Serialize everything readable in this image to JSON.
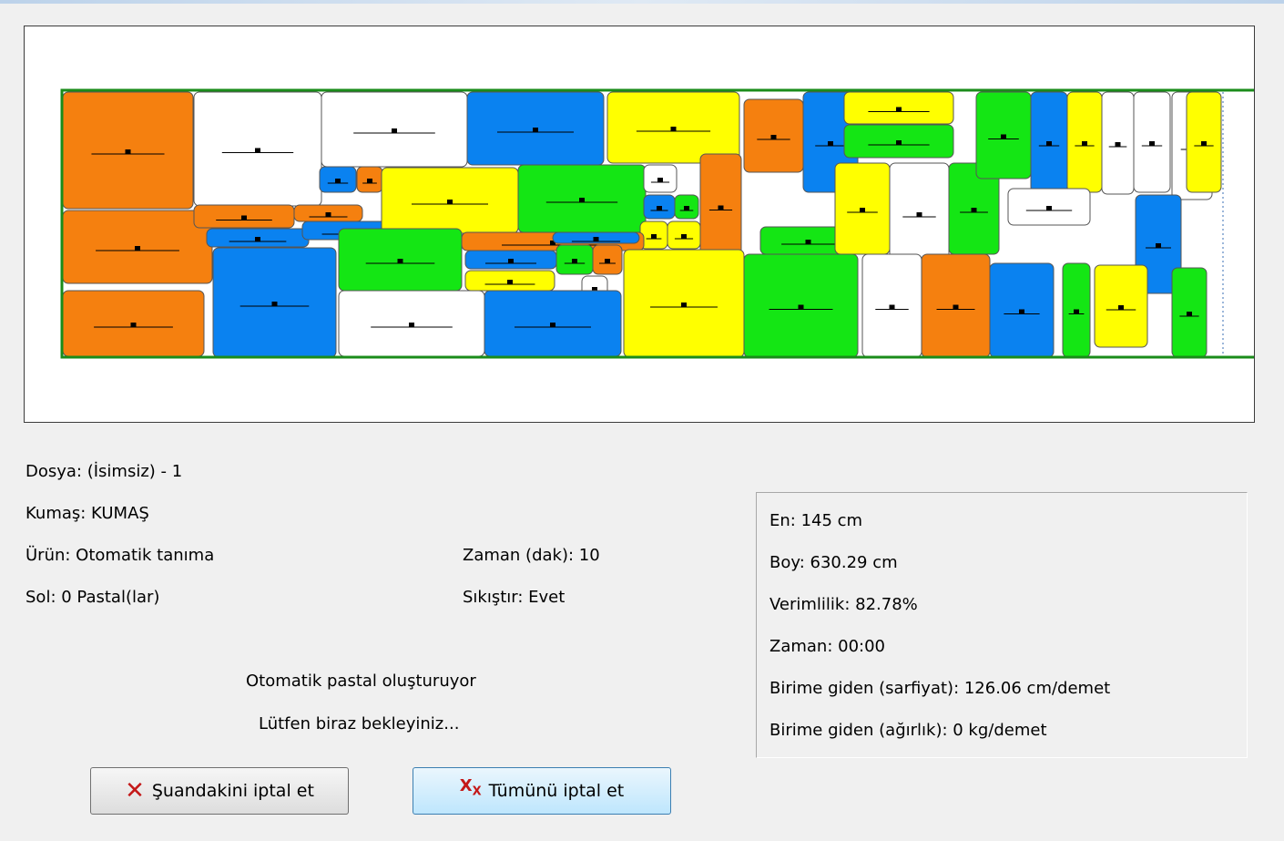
{
  "file_label": "Dosya: (İsimsiz) - 1",
  "fabric_label": "Kumaş: KUMAŞ",
  "product_label": "Ürün: Otomatik tanıma",
  "left_label": "Sol: 0 Pastal(lar)",
  "time_limit_label": "Zaman (dak): 10",
  "compress_label": "Sıkıştır: Evet",
  "status_line1": "Otomatik pastal oluşturuyor",
  "status_line2": "Lütfen biraz bekleyiniz...",
  "stats": {
    "width": "En: 145 cm",
    "length": "Boy: 630.29 cm",
    "efficiency": "Verimlilik: 82.78%",
    "time": "Zaman: 00:00",
    "consumption": "Birime giden (sarfiyat): 126.06 cm/demet",
    "weight": "Birime giden (ağırlık): 0 kg/demet"
  },
  "buttons": {
    "cancel_current": "Şuandakini iptal et",
    "cancel_all": "Tümünü iptal et"
  },
  "icons": {
    "cancel_current": "red-x-icon",
    "cancel_all": "red-double-x-icon"
  },
  "colors": {
    "orange": "#f5800f",
    "blue": "#0a82f0",
    "yellow": "#ffff00",
    "green": "#14e614",
    "white": "#ffffff",
    "border_green": "#1a8c1a"
  }
}
